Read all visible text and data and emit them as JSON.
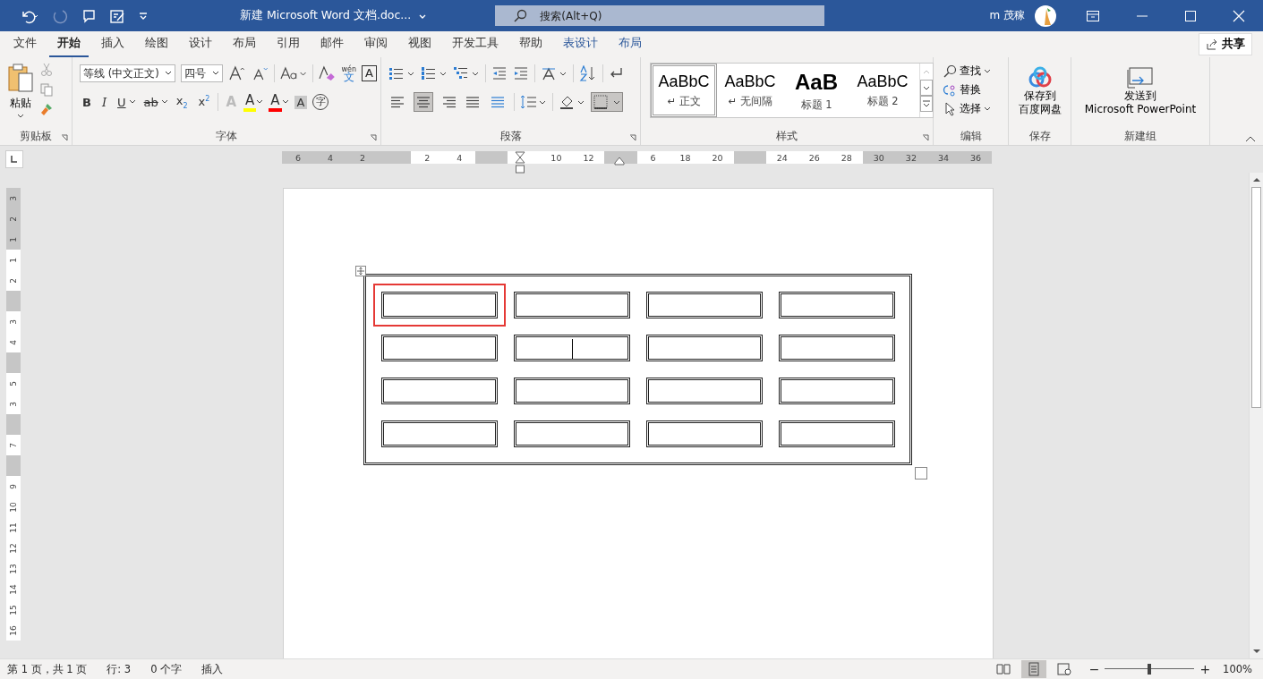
{
  "title_bar": {
    "title": "新建 Microsoft Word 文档.doc...",
    "search": {
      "placeholder": "搜索(Alt+Q)"
    },
    "user": "m 茂稼"
  },
  "menu": [
    {
      "label": "文件",
      "selected": false,
      "kind": "normal"
    },
    {
      "label": "开始",
      "selected": true,
      "kind": "normal"
    },
    {
      "label": "插入",
      "selected": false,
      "kind": "normal"
    },
    {
      "label": "绘图",
      "selected": false,
      "kind": "normal"
    },
    {
      "label": "设计",
      "selected": false,
      "kind": "normal"
    },
    {
      "label": "布局",
      "selected": false,
      "kind": "normal"
    },
    {
      "label": "引用",
      "selected": false,
      "kind": "normal"
    },
    {
      "label": "邮件",
      "selected": false,
      "kind": "normal"
    },
    {
      "label": "审阅",
      "selected": false,
      "kind": "normal"
    },
    {
      "label": "视图",
      "selected": false,
      "kind": "normal"
    },
    {
      "label": "开发工具",
      "selected": false,
      "kind": "normal"
    },
    {
      "label": "帮助",
      "selected": false,
      "kind": "normal"
    },
    {
      "label": "表设计",
      "selected": false,
      "kind": "contextual"
    },
    {
      "label": "布局",
      "selected": false,
      "kind": "contextual"
    }
  ],
  "share_button": "共享",
  "clipboard": {
    "paste": "粘贴",
    "group": "剪贴板"
  },
  "font": {
    "name": "等线 (中文正文)",
    "size": "四号",
    "group": "字体",
    "phonetic": "wén",
    "phonetic_base": "文",
    "border_label": "A",
    "format_buttons": [
      {
        "label": "B",
        "kind": "bold"
      },
      {
        "label": "I",
        "kind": "italic"
      },
      {
        "label": "U",
        "kind": "underline"
      },
      {
        "label": "ab",
        "kind": "strike"
      },
      {
        "label": "x$_{2}$",
        "kind": "plain"
      },
      {
        "label": "x$^{2}$",
        "kind": "plain"
      }
    ],
    "effects": [
      {
        "label": "A",
        "kind": "effect"
      },
      {
        "label": "A",
        "kind": "highlight",
        "color": "#ffff00"
      },
      {
        "label": "A",
        "kind": "color",
        "color": "#ff0000"
      },
      {
        "label": "A",
        "kind": "shade"
      },
      {
        "label": "字",
        "kind": "enclose"
      }
    ]
  },
  "paragraph": {
    "group": "段落",
    "alignments": [
      {
        "kind": "left",
        "selected": false
      },
      {
        "kind": "center",
        "selected": true
      },
      {
        "kind": "right",
        "selected": false
      },
      {
        "kind": "justify",
        "selected": false
      },
      {
        "kind": "distributed",
        "selected": false
      }
    ]
  },
  "styles": {
    "group": "样式",
    "items": [
      {
        "preview": "AaBbC",
        "name": "↵ 正文",
        "selected": true,
        "kind": "normal"
      },
      {
        "preview": "AaBbC",
        "name": "↵ 无间隔",
        "selected": false,
        "kind": "normal"
      },
      {
        "preview": "AaB",
        "name": "标题 1",
        "selected": false,
        "kind": "heading"
      },
      {
        "preview": "AaBbC",
        "name": "标题 2",
        "selected": false,
        "kind": "normal"
      }
    ]
  },
  "editing": {
    "group": "编辑",
    "find": "查找",
    "replace": "替换",
    "select": "选择"
  },
  "save": {
    "group": "保存",
    "lines": [
      "保存到",
      "百度网盘"
    ]
  },
  "new_group": {
    "group": "新建组",
    "lines": [
      "发送到",
      "Microsoft PowerPoint"
    ]
  },
  "h_ruler": [
    {
      "label": "6",
      "shaded": true
    },
    {
      "label": "4",
      "shaded": true
    },
    {
      "label": "2",
      "shaded": true
    },
    {
      "shaded": true
    },
    {
      "label": "2",
      "shaded": false
    },
    {
      "label": "4",
      "shaded": false
    },
    {
      "shaded": true
    },
    {
      "shaded": false
    },
    {
      "label": "10",
      "shaded": false
    },
    {
      "label": "12",
      "shaded": false
    },
    {
      "shaded": true
    },
    {
      "label": "6",
      "shaded": false
    },
    {
      "label": "18",
      "shaded": false
    },
    {
      "label": "20",
      "shaded": false
    },
    {
      "shaded": true
    },
    {
      "label": "24",
      "shaded": false
    },
    {
      "label": "26",
      "shaded": false
    },
    {
      "label": "28",
      "shaded": false
    },
    {
      "label": "30",
      "shaded": true
    },
    {
      "label": "32",
      "shaded": true
    },
    {
      "label": "34",
      "shaded": true
    },
    {
      "label": "36",
      "shaded": true
    }
  ],
  "v_ruler": [
    {
      "label": "3",
      "shaded": true
    },
    {
      "label": "2",
      "shaded": true
    },
    {
      "label": "1",
      "shaded": true
    },
    {
      "label": "1",
      "shaded": false
    },
    {
      "label": "2",
      "shaded": false
    },
    {
      "shaded": true
    },
    {
      "label": "3",
      "shaded": false
    },
    {
      "label": "4",
      "shaded": false
    },
    {
      "shaded": true
    },
    {
      "label": "5",
      "shaded": false
    },
    {
      "label": "3",
      "shaded": false
    },
    {
      "shaded": true
    },
    {
      "label": "7",
      "shaded": false
    },
    {
      "shaded": true
    },
    {
      "label": "9",
      "shaded": false
    },
    {
      "label": "10",
      "shaded": false
    },
    {
      "label": "11",
      "shaded": false
    },
    {
      "label": "12",
      "shaded": false
    },
    {
      "label": "13",
      "shaded": false
    },
    {
      "label": "14",
      "shaded": false
    },
    {
      "label": "15",
      "shaded": false
    },
    {
      "label": "16",
      "shaded": false
    }
  ],
  "table": {
    "rows": [
      [
        {
          "selected": true,
          "cursor": false
        },
        {
          "selected": false,
          "cursor": false
        },
        {
          "selected": false,
          "cursor": false
        },
        {
          "selected": false,
          "cursor": false
        }
      ],
      [
        {
          "selected": false,
          "cursor": false
        },
        {
          "selected": false,
          "cursor": true
        },
        {
          "selected": false,
          "cursor": false
        },
        {
          "selected": false,
          "cursor": false
        }
      ],
      [
        {
          "selected": false,
          "cursor": false
        },
        {
          "selected": false,
          "cursor": false
        },
        {
          "selected": false,
          "cursor": false
        },
        {
          "selected": false,
          "cursor": false
        }
      ],
      [
        {
          "selected": false,
          "cursor": false
        },
        {
          "selected": false,
          "cursor": false
        },
        {
          "selected": false,
          "cursor": false
        },
        {
          "selected": false,
          "cursor": false
        }
      ]
    ]
  },
  "status_bar": {
    "items": [
      "第 1 页，共 1 页",
      "行: 3",
      "0 个字",
      "插入"
    ],
    "zoom": {
      "out": "−",
      "in": "+",
      "level": 0.5,
      "reading": "100%"
    }
  }
}
